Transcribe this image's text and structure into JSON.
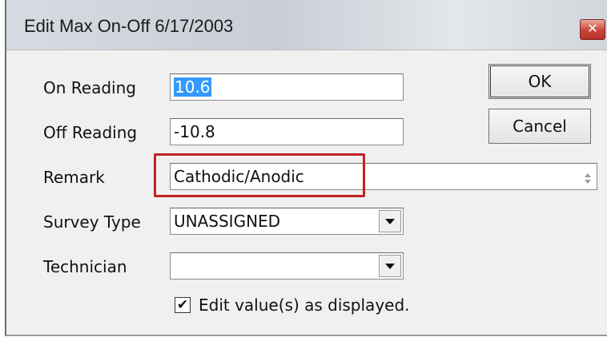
{
  "window": {
    "title": "Edit Max On-Off 6/17/2003",
    "close_glyph": "✕"
  },
  "form": {
    "on_reading_label": "On Reading",
    "on_reading_value": "10.6",
    "off_reading_label": "Off Reading",
    "off_reading_value": "-10.8",
    "remark_label": "Remark",
    "remark_value": "Cathodic/Anodic",
    "survey_type_label": "Survey Type",
    "survey_type_value": "UNASSIGNED",
    "technician_label": "Technician",
    "technician_value": "",
    "edit_as_displayed_label": "Edit value(s) as displayed.",
    "edit_as_displayed_checked": true,
    "check_glyph": "✔"
  },
  "buttons": {
    "ok": "OK",
    "cancel": "Cancel"
  },
  "annotation": {
    "highlight_color": "#c22222"
  }
}
